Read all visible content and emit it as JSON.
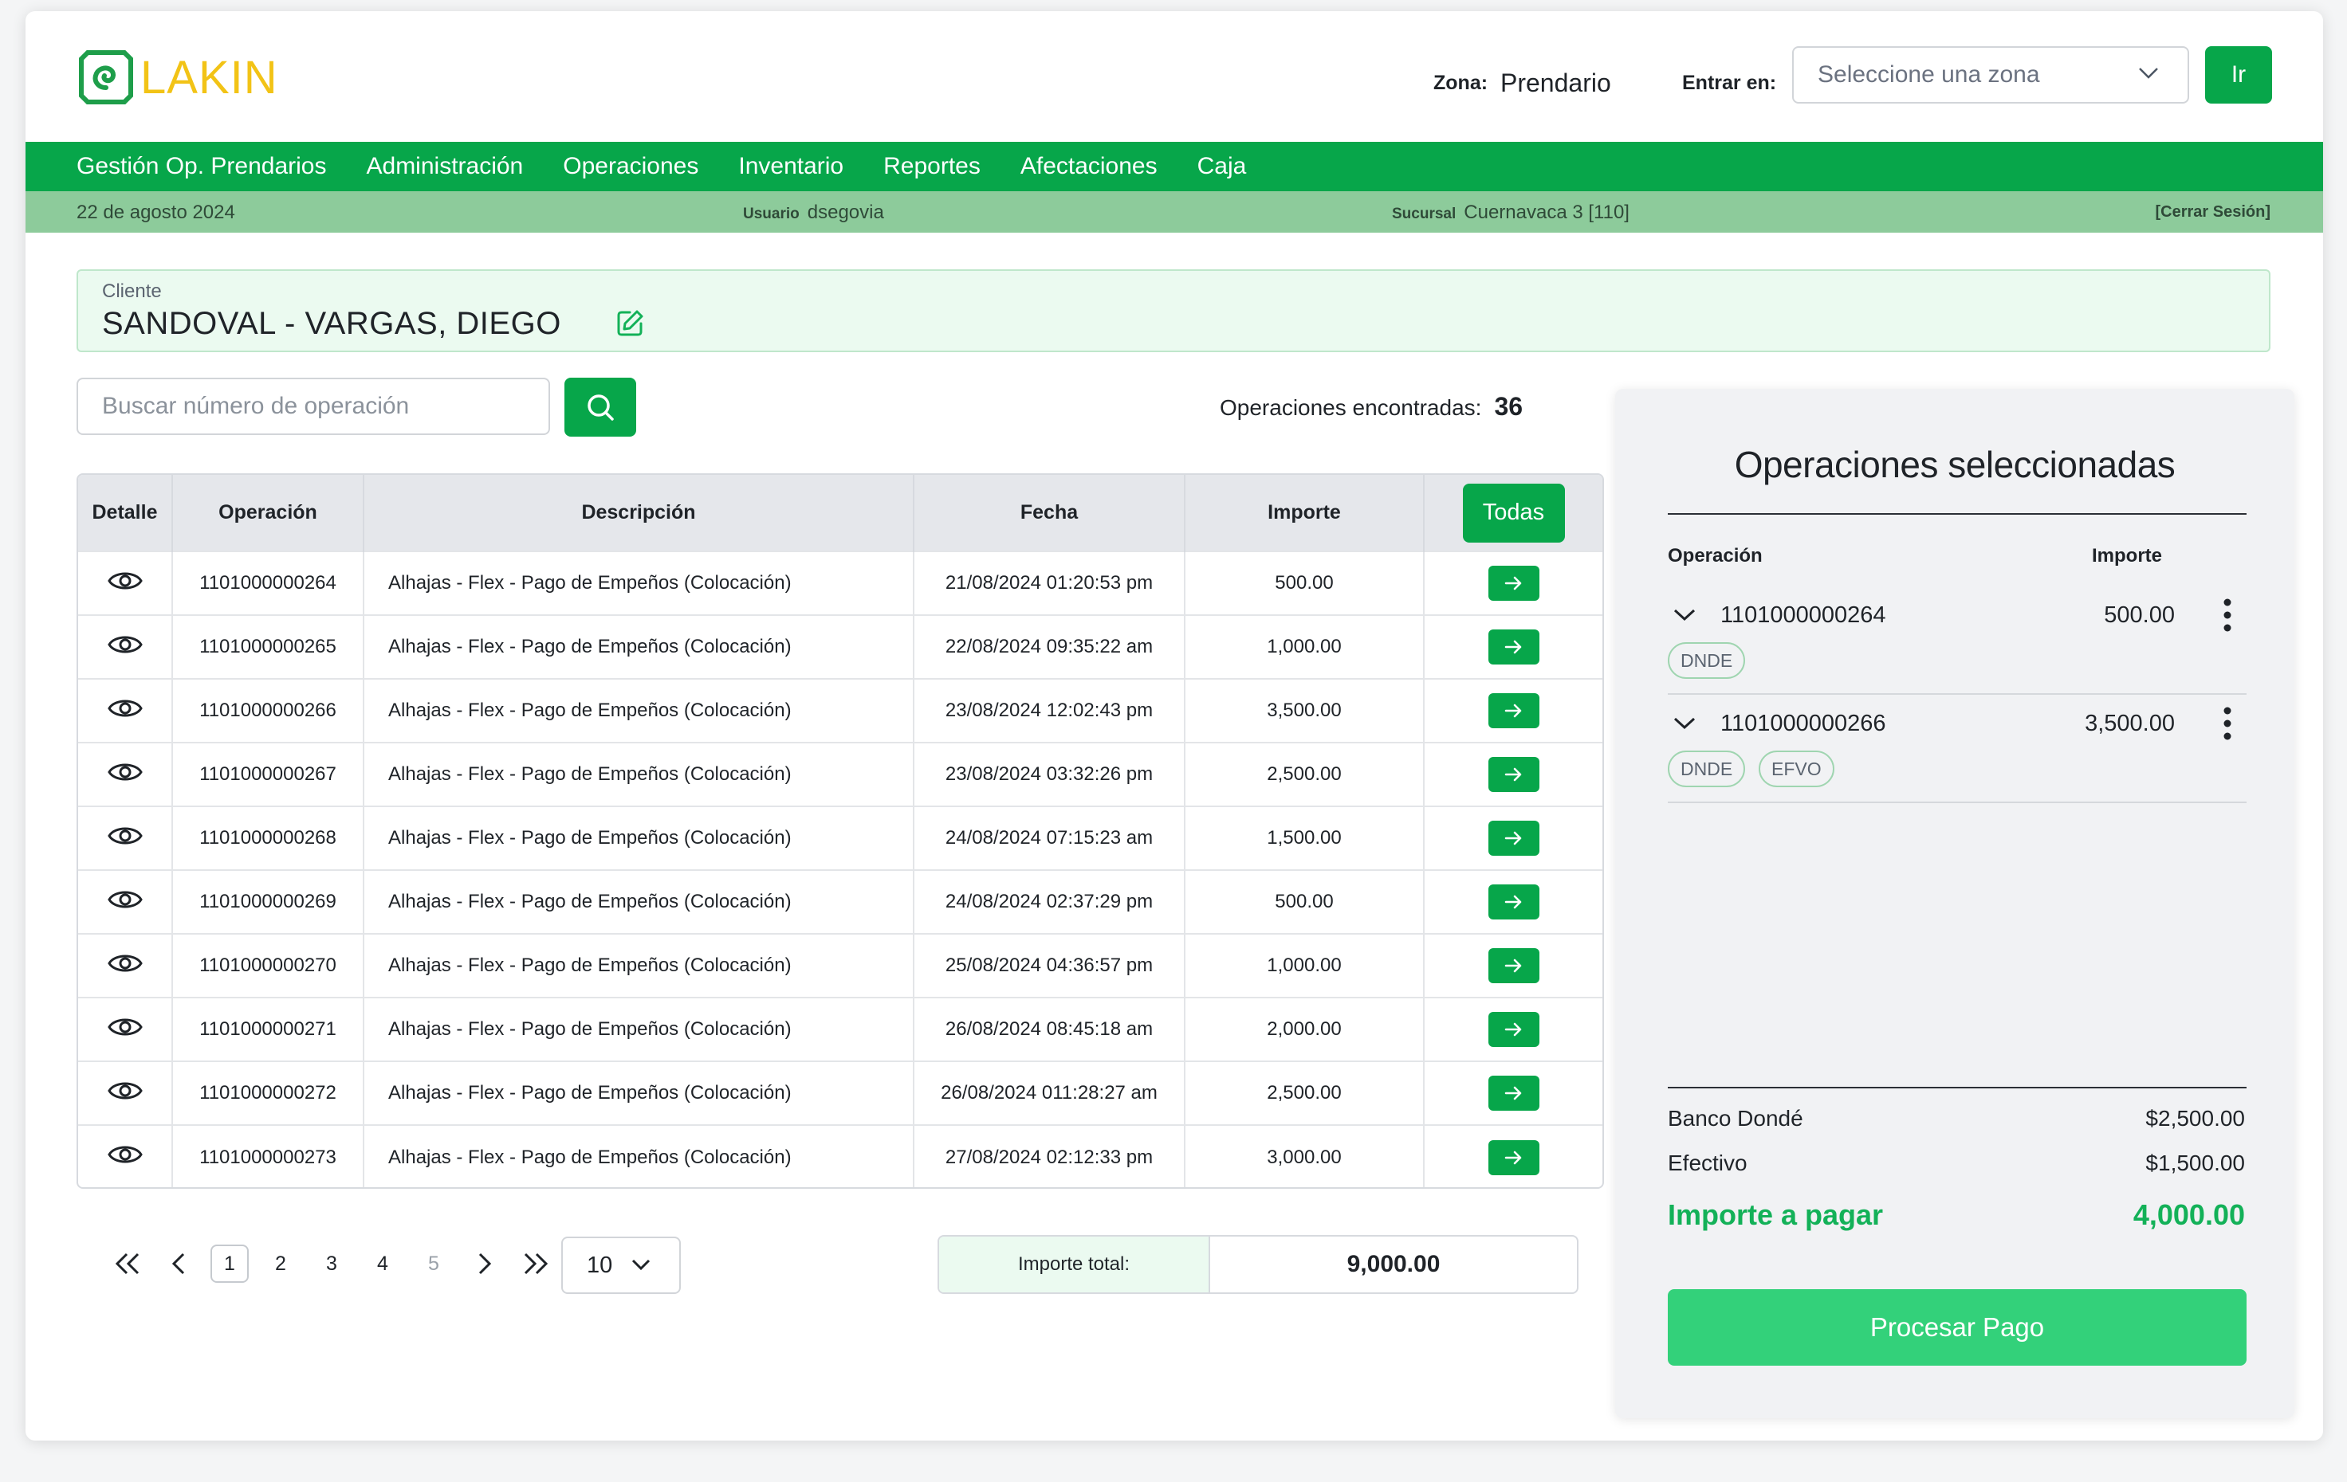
{
  "brand": {
    "name": "LAKIN",
    "logo_color": "#1e9e4a",
    "text_color": "#f2c316"
  },
  "header": {
    "zona_label": "Zona:",
    "zona_value": "Prendario",
    "entrar_label": "Entrar en:",
    "zone_select_placeholder": "Seleccione una zona",
    "go_label": "Ir"
  },
  "nav": [
    "Gestión Op. Prendarios",
    "Administración",
    "Operaciones",
    "Inventario",
    "Reportes",
    "Afectaciones",
    "Caja"
  ],
  "infobar": {
    "date": "22 de agosto 2024",
    "usuario_label": "Usuario",
    "usuario": "dsegovia",
    "sucursal_label": "Sucursal",
    "sucursal": "Cuernavaca 3 [110]",
    "logout": "[Cerrar Sesión]"
  },
  "client": {
    "label": "Cliente",
    "name": "SANDOVAL - VARGAS, DIEGO"
  },
  "search": {
    "placeholder": "Buscar número de operación"
  },
  "found": {
    "label": "Operaciones encontradas:",
    "count": "36"
  },
  "table": {
    "headers": [
      "Detalle",
      "Operación",
      "Descripción",
      "Fecha",
      "Importe",
      "Todas"
    ],
    "rows": [
      {
        "op": "1101000000264",
        "desc": "Alhajas - Flex - Pago de Empeños (Colocación)",
        "fecha": "21/08/2024 01:20:53 pm",
        "importe": "500.00"
      },
      {
        "op": "1101000000265",
        "desc": "Alhajas - Flex - Pago de Empeños (Colocación)",
        "fecha": "22/08/2024 09:35:22 am",
        "importe": "1,000.00"
      },
      {
        "op": "1101000000266",
        "desc": "Alhajas - Flex - Pago de Empeños (Colocación)",
        "fecha": "23/08/2024 12:02:43 pm",
        "importe": "3,500.00"
      },
      {
        "op": "1101000000267",
        "desc": "Alhajas - Flex - Pago de Empeños (Colocación)",
        "fecha": "23/08/2024 03:32:26 pm",
        "importe": "2,500.00"
      },
      {
        "op": "1101000000268",
        "desc": "Alhajas - Flex - Pago de Empeños (Colocación)",
        "fecha": "24/08/2024 07:15:23 am",
        "importe": "1,500.00"
      },
      {
        "op": "1101000000269",
        "desc": "Alhajas - Flex - Pago de Empeños (Colocación)",
        "fecha": "24/08/2024 02:37:29 pm",
        "importe": "500.00"
      },
      {
        "op": "1101000000270",
        "desc": "Alhajas - Flex - Pago de Empeños (Colocación)",
        "fecha": "25/08/2024 04:36:57 pm",
        "importe": "1,000.00"
      },
      {
        "op": "1101000000271",
        "desc": "Alhajas - Flex - Pago de Empeños (Colocación)",
        "fecha": "26/08/2024 08:45:18 am",
        "importe": "2,000.00"
      },
      {
        "op": "1101000000272",
        "desc": "Alhajas - Flex - Pago de Empeños (Colocación)",
        "fecha": "26/08/2024 011:28:27 am",
        "importe": "2,500.00"
      },
      {
        "op": "1101000000273",
        "desc": "Alhajas - Flex - Pago de Empeños (Colocación)",
        "fecha": "27/08/2024 02:12:33 pm",
        "importe": "3,000.00"
      }
    ]
  },
  "pagination": {
    "pages": [
      "1",
      "2",
      "3",
      "4",
      "5"
    ],
    "current": "1",
    "per_page": "10"
  },
  "total": {
    "label": "Importe total:",
    "value": "9,000.00"
  },
  "panel": {
    "title": "Operaciones seleccionadas",
    "col_op": "Operación",
    "col_importe": "Importe",
    "items": [
      {
        "op": "1101000000264",
        "importe": "500.00",
        "tags": [
          "DNDE"
        ]
      },
      {
        "op": "1101000000266",
        "importe": "3,500.00",
        "tags": [
          "DNDE",
          "EFVO"
        ]
      }
    ],
    "banco_label": "Banco Dondé",
    "banco_value": "$2,500.00",
    "efectivo_label": "Efectivo",
    "efectivo_value": "$1,500.00",
    "pagar_label": "Importe a pagar",
    "pagar_value": "4,000.00",
    "process_label": "Procesar Pago"
  },
  "colors": {
    "primary": "#07a64a",
    "infobar": "#8dcb9b",
    "accent_text": "#13b158",
    "process_button": "#33d17a",
    "client_bg": "#ebfaf0"
  }
}
